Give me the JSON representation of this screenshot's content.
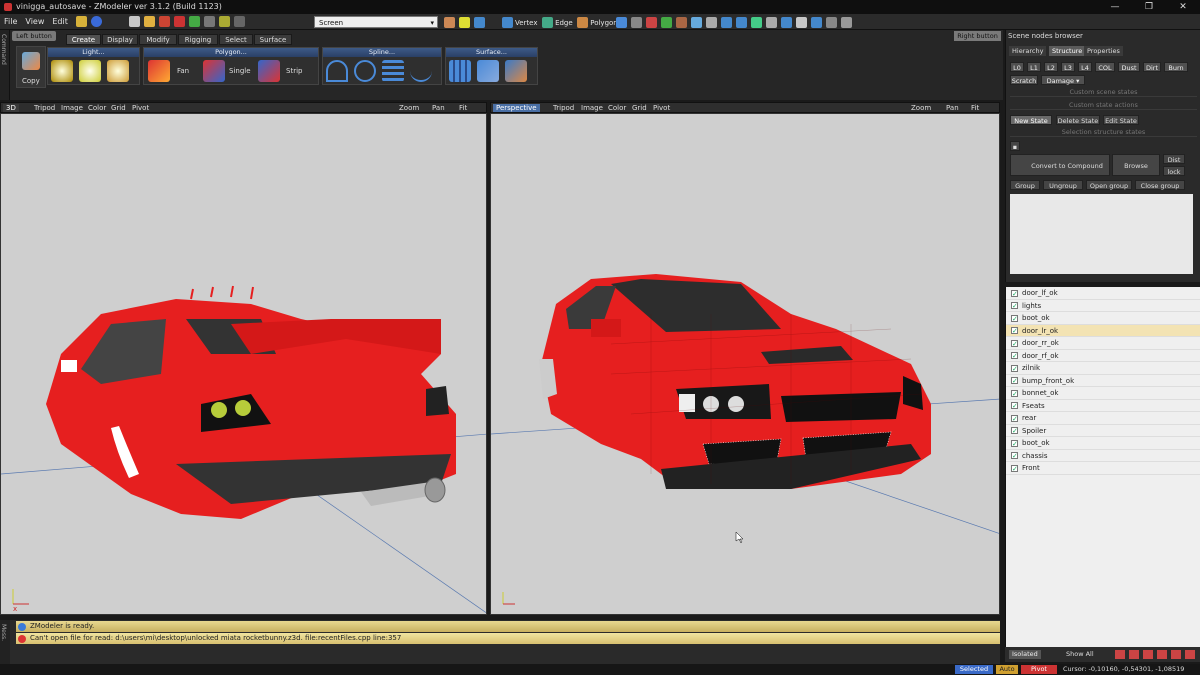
{
  "title": "vinigga_autosave - ZModeler ver 3.1.2 (Build 1123)",
  "menu": [
    "File",
    "View",
    "Edit"
  ],
  "toolbar": {
    "screen": "Screen",
    "vertex": "Vertex",
    "edge": "Edge",
    "polygon": "Polygon"
  },
  "left_strip": "Command",
  "left_strip2": "Mess.",
  "left_button": "Left button",
  "right_button": "Right button",
  "tabs": [
    "Create",
    "Display",
    "Modify",
    "Rigging",
    "Select",
    "Surface"
  ],
  "groups": {
    "light": "Light...",
    "polygon": "Polygon...",
    "spline": "Spline...",
    "surface": "Surface..."
  },
  "buttons": {
    "copy": "Copy",
    "fan": "Fan",
    "single": "Single",
    "strip": "Strip"
  },
  "vp_left": {
    "title": "3D",
    "items": [
      "Tripod",
      "Image",
      "Color",
      "Grid",
      "Pivot"
    ],
    "zoom": "Zoom",
    "pan": "Pan",
    "fit": "Fit"
  },
  "vp_right": {
    "title": "Perspective",
    "items": [
      "Tripod",
      "Image",
      "Color",
      "Grid",
      "Pivot"
    ],
    "zoom": "Zoom",
    "pan": "Pan",
    "fit": "Fit"
  },
  "panel": {
    "title": "Scene nodes browser",
    "tabs": [
      "Hierarchy",
      "Structure",
      "Properties"
    ],
    "lods": [
      "L0",
      "L1",
      "L2",
      "L3",
      "L4",
      "COL",
      "Dust",
      "Dirt",
      "Burn"
    ],
    "scratch": "Scratch",
    "damage": "Damage",
    "custom_scene": "Custom scene states",
    "custom_actions": "Custom state actions",
    "new_state": "New State",
    "delete_state": "Delete State",
    "edit_state": "Edit State",
    "selection": "Selection structure states",
    "convert": "Convert to Compound",
    "browse": "Browse",
    "dist": "Dist",
    "lock": "lock",
    "group": "Group",
    "ungroup": "Ungroup",
    "open_group": "Open group",
    "close_group": "Close group"
  },
  "nodes": [
    "door_lf_ok",
    "lights",
    "boot_ok",
    "door_lr_ok",
    "door_rr_ok",
    "door_rf_ok",
    "zilnik",
    "bump_front_ok",
    "bonnet_ok",
    "Fseats",
    "rear",
    "Spoiler",
    "boot_ok",
    "chassis",
    "Front"
  ],
  "node_bar": {
    "isolated": "Isolated",
    "show_all": "Show All"
  },
  "messages": [
    "ZModeler is ready.",
    "Can't open file for read: d:\\users\\mi\\desktop\\unlocked miata rocketbunny.z3d. file:recentFiles.cpp line:357"
  ],
  "status": {
    "selected": "Selected",
    "auto": "Auto",
    "pivot": "Pivot",
    "cursor": "Cursor: -0,10160, -0,54301, -1,08519"
  }
}
